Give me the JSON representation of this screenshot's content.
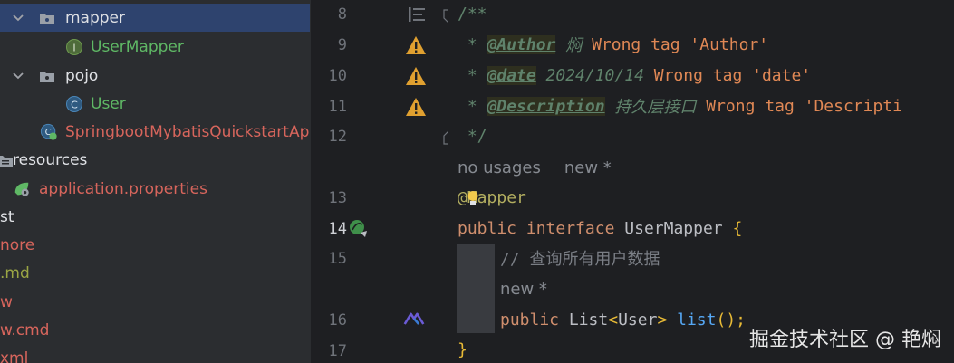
{
  "project_tree": {
    "items": [
      {
        "label": "mapper",
        "color": "#dfe1e5"
      },
      {
        "label": "UserMapper",
        "color": "#5fb865",
        "icon_letter": "I"
      },
      {
        "label": "pojo",
        "color": "#dfe1e5"
      },
      {
        "label": "User",
        "color": "#5fb865",
        "icon_letter": "C"
      },
      {
        "label": "SpringbootMybatisQuickstartApp",
        "color": "#d7655c"
      },
      {
        "label": "resources",
        "color": "#dfe1e5"
      },
      {
        "label": "application.properties",
        "color": "#d7655c"
      },
      {
        "label": "st",
        "color": "#dfe1e5"
      },
      {
        "label": "nore",
        "color": "#d7655c"
      },
      {
        "label": ".md",
        "color": "#9aa544"
      },
      {
        "label": "w",
        "color": "#d7655c"
      },
      {
        "label": "w.cmd",
        "color": "#d7655c"
      },
      {
        "label": "xml",
        "color": "#d7655c"
      }
    ]
  },
  "gutter": {
    "line_numbers": [
      "8",
      "9",
      "10",
      "11",
      "12",
      "13",
      "14",
      "15",
      "16",
      "17"
    ]
  },
  "editor": {
    "l8": "/**",
    "l9": {
      "star": " * ",
      "tag": "@Author",
      "val": " 焖 ",
      "warn": "Wrong tag 'Author'"
    },
    "l10": {
      "star": " * ",
      "tag": "@date",
      "val": " 2024/10/14 ",
      "warn": "Wrong tag 'date'"
    },
    "l11": {
      "star": " * ",
      "tag": "@Description",
      "val": " 持久层接口 ",
      "warn": "Wrong tag 'Descripti"
    },
    "l12": " */",
    "inlay1": {
      "usages": "no usages",
      "author": "new *"
    },
    "l13": {
      "at": "@",
      "name": "Mapper"
    },
    "l14": {
      "kw1": "public",
      "kw2": "interface",
      "name": "UserMapper",
      "brace": "{"
    },
    "l15": "// 查询所有用户数据",
    "inlay2": "new *",
    "l16": {
      "kw": "public",
      "type": "List",
      "lt": "<",
      "generic": "User",
      "gt": ">",
      "method": "list",
      "parens": "();"
    },
    "l17": "}"
  },
  "watermark": "掘金技术社区 @ 艳焖",
  "colors": {
    "background": "#1e1f22",
    "sidebar": "#2b2d30",
    "selection": "#2e436e",
    "warning": "#e0a030",
    "keyword": "#cf8e6d",
    "method": "#56a8f5"
  }
}
